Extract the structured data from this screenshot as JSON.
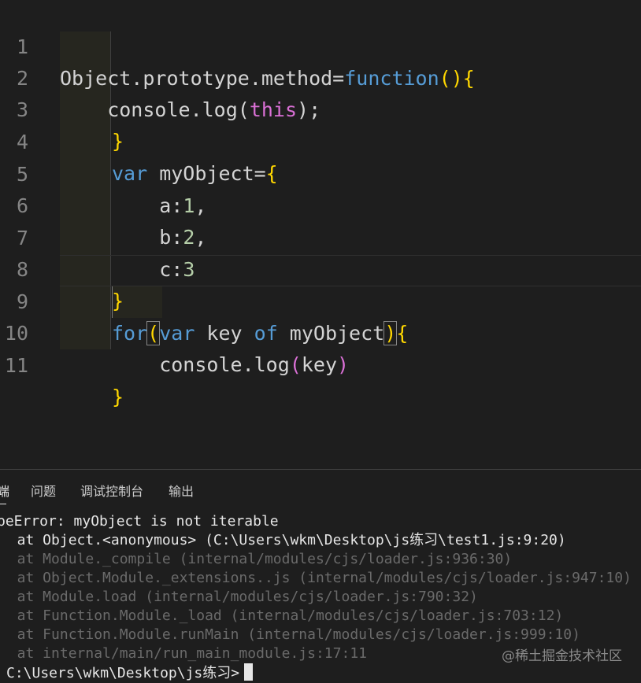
{
  "editor": {
    "lines": [
      {
        "number": "1"
      },
      {
        "number": "2"
      },
      {
        "number": "3"
      },
      {
        "number": "4"
      },
      {
        "number": "5"
      },
      {
        "number": "6"
      },
      {
        "number": "7"
      },
      {
        "number": "8"
      },
      {
        "number": "9"
      },
      {
        "number": "10"
      },
      {
        "number": "11"
      }
    ],
    "tokens": {
      "l1a": "Object.prototype.method=",
      "l1b": "function",
      "l1c": "(){",
      "l2a": "    console.log(",
      "l2b": "this",
      "l2c": ");",
      "l3": "}",
      "l4a": "var",
      "l4b": " myObject=",
      "l4c": "{",
      "l5a": "    a:",
      "l5b": "1",
      "l5c": ",",
      "l6a": "    b:",
      "l6b": "2",
      "l6c": ",",
      "l7a": "    c:",
      "l7b": "3",
      "l8": "}",
      "l9a": "for",
      "l9b": "(",
      "l9c": "var",
      "l9d": " key ",
      "l9e": "of",
      "l9f": " myObject",
      "l9g": ")",
      "l9h": "{",
      "l10a": "    console.log",
      "l10b": "(",
      "l10c": "key",
      "l10d": ")",
      "l11": "}"
    },
    "colors": {
      "background": "#1e1e1e",
      "keyword": "#569cd6",
      "bracket_level1": "#ffd700",
      "bracket_level2": "#da70d6",
      "number": "#b5cea8",
      "text": "#d4d4d4",
      "line_number": "#858585"
    }
  },
  "panel": {
    "tabs": [
      {
        "label": "端",
        "active": true
      },
      {
        "label": "问题"
      },
      {
        "label": "调试控制台"
      },
      {
        "label": "输出"
      }
    ],
    "terminal": {
      "lines": [
        {
          "text": "peError: myObject is not iterable",
          "dim": false
        },
        {
          "text": "  at Object.<anonymous> (C:\\Users\\wkm\\Desktop\\js练习\\test1.js:9:20)",
          "dim": false
        },
        {
          "text": "  at Module._compile (internal/modules/cjs/loader.js:936:30)",
          "dim": true
        },
        {
          "text": "  at Object.Module._extensions..js (internal/modules/cjs/loader.js:947:10)",
          "dim": true
        },
        {
          "text": "  at Module.load (internal/modules/cjs/loader.js:790:32)",
          "dim": true
        },
        {
          "text": "  at Function.Module._load (internal/modules/cjs/loader.js:703:12)",
          "dim": true
        },
        {
          "text": "  at Function.Module.runMain (internal/modules/cjs/loader.js:999:10)",
          "dim": true
        },
        {
          "text": "  at internal/main/run_main_module.js:17:11",
          "dim": true
        }
      ],
      "prompt": "C:\\Users\\wkm\\Desktop\\js练习>"
    },
    "watermark": "@稀土掘金技术社区"
  }
}
